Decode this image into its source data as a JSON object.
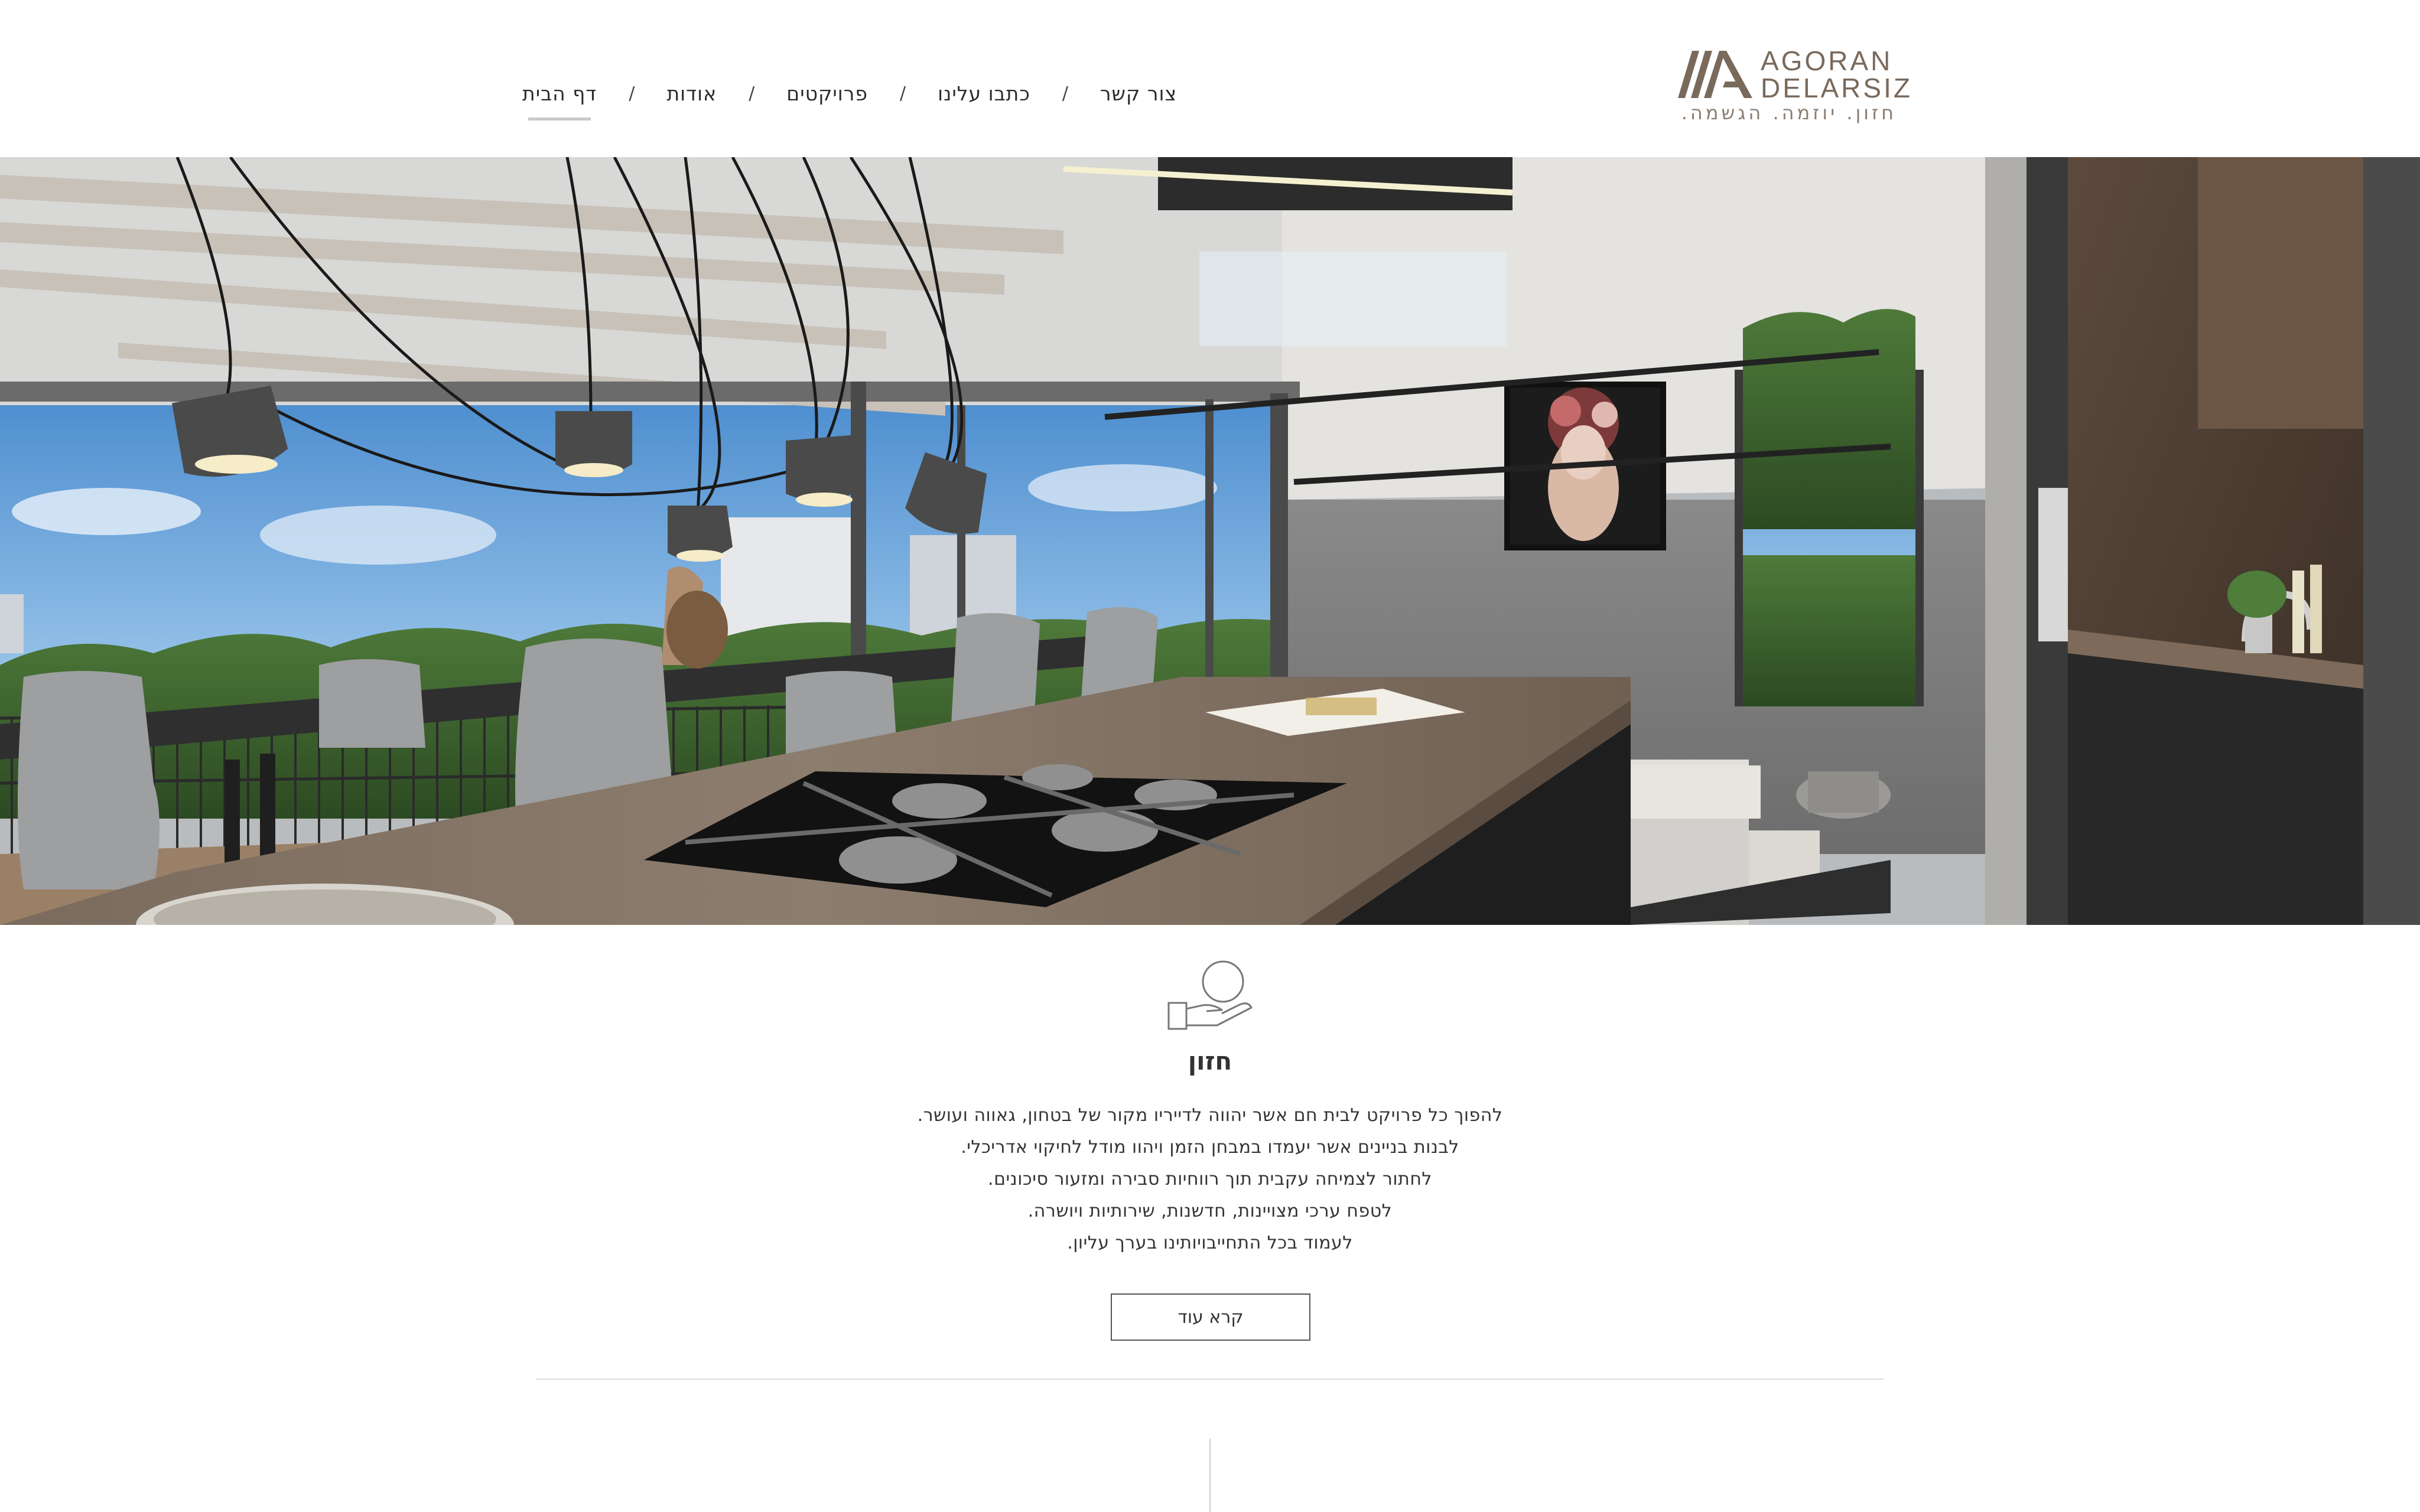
{
  "nav": {
    "items": [
      {
        "label": "דף הבית",
        "active": true
      },
      {
        "label": "אודות",
        "active": false
      },
      {
        "label": "פרויקטים",
        "active": false
      },
      {
        "label": "כתבו עלינו",
        "active": false
      },
      {
        "label": "צור קשר",
        "active": false
      }
    ],
    "separator": "/"
  },
  "logo": {
    "line1": "AGORAN",
    "line2": "DELARSIZ",
    "tagline": "חזון. יוזמה. הגשמה.",
    "color": "#7a6a5c"
  },
  "hero": {
    "image": "kitchen-living-room-render"
  },
  "vision": {
    "icon": "hand-with-coin-icon",
    "title": "חזון",
    "lines": [
      "להפוך כל פרויקט לבית חם אשר יהווה לדייריו מקור של בטחון, גאווה ועושר.",
      "לבנות בניינים אשר יעמדו במבחן הזמן ויהוו מודל לחיקוי אדריכלי.",
      "לחתור לצמיחה עקבית תוך רווחיות סבירה ומזעור סיכונים.",
      "לטפח ערכי מצויינות, חדשנות, שירותיות ויושרה.",
      "לעמוד בכל התחייבויותינו בערך עליון."
    ],
    "button_label": "קרא עוד"
  }
}
